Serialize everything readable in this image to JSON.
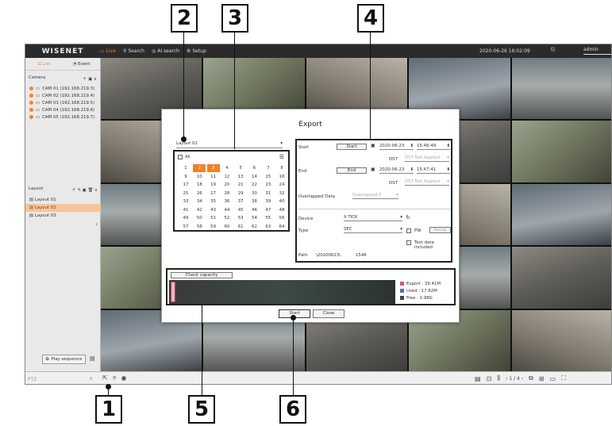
{
  "callouts": [
    "1",
    "2",
    "3",
    "4",
    "5",
    "6"
  ],
  "app": {
    "brand": "WISENET",
    "nav": [
      {
        "label": "Live",
        "icon": "monitor-icon"
      },
      {
        "label": "Search",
        "icon": "search-icon"
      },
      {
        "label": "AI search",
        "icon": "ai-search-icon"
      },
      {
        "label": "Setup",
        "icon": "gear-icon"
      }
    ],
    "datetime": "2020-06-26 16:02:09",
    "user": "admin"
  },
  "left": {
    "tabs": [
      "List",
      "Event"
    ],
    "camera_header": "Camera",
    "cameras": [
      "CAM 01 (192.168.219.3)",
      "CAM 02 (192.168.219.4)",
      "CAM 03 (192.168.219.5)",
      "CAM 04 (192.168.219.6)",
      "CAM 05 (192.168.219.7)"
    ],
    "layout_header": "Layout",
    "layouts": [
      "Layout 01",
      "Layout 02",
      "Layout 03"
    ],
    "selected_layout": 1,
    "play_sequence": "Play sequence"
  },
  "bottom": {
    "ptz": "PTZ",
    "page_current": "1",
    "page_total": "4"
  },
  "dialog": {
    "title": "Export",
    "layout_value": "Layout 02",
    "all_label": "All",
    "channels": [
      "1",
      "2",
      "3",
      "4",
      "5",
      "6",
      "7",
      "8",
      "9",
      "10",
      "11",
      "12",
      "13",
      "14",
      "15",
      "16",
      "17",
      "18",
      "19",
      "20",
      "21",
      "22",
      "23",
      "24",
      "25",
      "26",
      "27",
      "28",
      "29",
      "30",
      "31",
      "32",
      "33",
      "34",
      "35",
      "36",
      "37",
      "38",
      "39",
      "40",
      "41",
      "42",
      "43",
      "44",
      "45",
      "46",
      "47",
      "48",
      "49",
      "50",
      "51",
      "52",
      "53",
      "54",
      "55",
      "56",
      "57",
      "58",
      "59",
      "60",
      "61",
      "62",
      "63",
      "64"
    ],
    "selected_channels": [
      "2",
      "3"
    ],
    "start_label": "Start",
    "start_button": "Start",
    "start_date": "2020-06-23",
    "start_time": "15:46:49",
    "dst_label": "DST",
    "dst_value": "DST Not Applied",
    "end_label": "End",
    "end_button": "End",
    "end_date": "2020-06-23",
    "end_time": "15:47:41",
    "overlapped_label": "Overlapped Data",
    "overlapped_value": "Overlapped 0",
    "device_label": "Device",
    "device_value": "X TICK",
    "type_label": "Type",
    "type_value": "SEC",
    "pw_label": "PW",
    "setup_button": "Setup",
    "text_data_label": "Text data included",
    "path_label": "Path",
    "path_value": "\\20200623\\",
    "path_number": "1546",
    "check_capacity": "Check capacity",
    "legend": [
      {
        "label": "Export : 39.41M",
        "color": "#d9537a"
      },
      {
        "label": "Used   : 17.82M",
        "color": "#5b6bb5"
      },
      {
        "label": "Free   : 1.98G",
        "color": "#444444"
      }
    ],
    "start_action": "Start",
    "close_action": "Close"
  }
}
